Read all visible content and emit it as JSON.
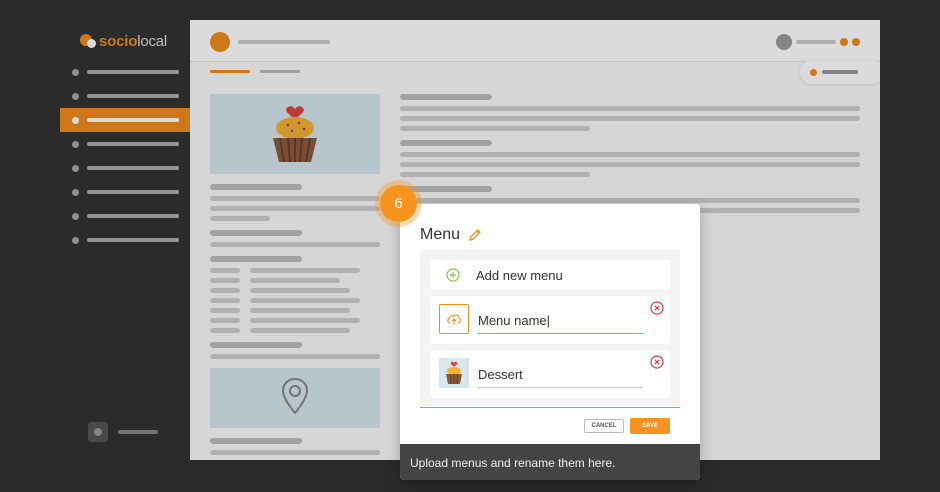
{
  "app": {
    "logo": {
      "prefix": "socio",
      "suffix": "local"
    }
  },
  "sidebar": {
    "item_count": 8,
    "active_index": 2
  },
  "modal": {
    "title": "Menu",
    "add_label": "Add new menu",
    "items": [
      {
        "name": "Menu name|",
        "state": "editing",
        "thumbnail": "upload-icon"
      },
      {
        "name": "Dessert",
        "state": "idle",
        "thumbnail": "cupcake-image"
      }
    ],
    "cancel_label": "CANCEL",
    "save_label": "SAVE"
  },
  "tour": {
    "step": "6",
    "tooltip": "Upload menus and rename them here."
  },
  "colors": {
    "accent": "#f08c1e",
    "sidebar": "#333333",
    "remove": "#d93b4a",
    "add": "#8bc34a"
  }
}
